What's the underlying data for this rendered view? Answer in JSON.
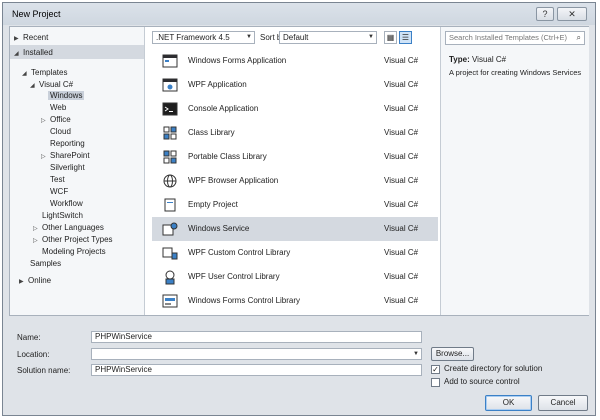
{
  "window": {
    "title": "New Project",
    "help_label": "?",
    "close_label": "✕"
  },
  "tree": {
    "recent": "Recent",
    "installed": "Installed",
    "templates": "Templates",
    "visual_csharp": "Visual C#",
    "windows": "Windows",
    "web": "Web",
    "office": "Office",
    "cloud": "Cloud",
    "reporting": "Reporting",
    "sharepoint": "SharePoint",
    "silverlight": "Silverlight",
    "test": "Test",
    "wcf": "WCF",
    "workflow": "Workflow",
    "lightswitch": "LightSwitch",
    "other_languages": "Other Languages",
    "other_project_types": "Other Project Types",
    "modeling_projects": "Modeling Projects",
    "samples": "Samples",
    "online": "Online"
  },
  "toolbar": {
    "framework": ".NET Framework 4.5",
    "sort_label": "Sort by:",
    "sort_value": "Default"
  },
  "templates": [
    {
      "name": "Windows Forms Application",
      "lang": "Visual C#",
      "icon": "windows-forms-icon"
    },
    {
      "name": "WPF Application",
      "lang": "Visual C#",
      "icon": "wpf-app-icon"
    },
    {
      "name": "Console Application",
      "lang": "Visual C#",
      "icon": "console-icon"
    },
    {
      "name": "Class Library",
      "lang": "Visual C#",
      "icon": "class-library-icon"
    },
    {
      "name": "Portable Class Library",
      "lang": "Visual C#",
      "icon": "portable-library-icon"
    },
    {
      "name": "WPF Browser Application",
      "lang": "Visual C#",
      "icon": "globe-icon"
    },
    {
      "name": "Empty Project",
      "lang": "Visual C#",
      "icon": "empty-project-icon"
    },
    {
      "name": "Windows Service",
      "lang": "Visual C#",
      "icon": "service-icon"
    },
    {
      "name": "WPF Custom Control Library",
      "lang": "Visual C#",
      "icon": "custom-control-icon"
    },
    {
      "name": "WPF User Control Library",
      "lang": "Visual C#",
      "icon": "user-control-icon"
    },
    {
      "name": "Windows Forms Control Library",
      "lang": "Visual C#",
      "icon": "forms-control-icon"
    }
  ],
  "selected_index": 7,
  "details": {
    "type_label": "Type:",
    "type_value": "Visual C#",
    "description": "A project for creating Windows Services",
    "search_placeholder": "Search Installed Templates (Ctrl+E)"
  },
  "form": {
    "name_label": "Name:",
    "name_value": "PHPWinService",
    "location_label": "Location:",
    "location_value": "",
    "solution_label": "Solution name:",
    "solution_value": "PHPWinService",
    "browse_label": "Browse...",
    "create_dir_label": "Create directory for solution",
    "create_dir_checked": true,
    "source_control_label": "Add to source control",
    "source_control_checked": false,
    "ok_label": "OK",
    "cancel_label": "Cancel"
  },
  "colors": {
    "selection": "#d4d9e0",
    "accent": "#3b80c6",
    "dialog_bg": "#dfe3e8"
  }
}
